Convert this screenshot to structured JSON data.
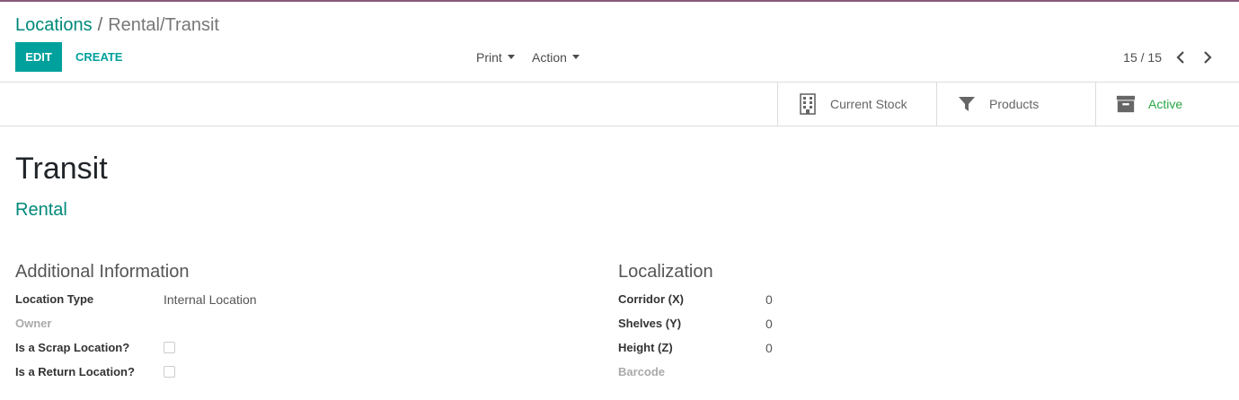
{
  "breadcrumb": {
    "parent": "Locations",
    "separator": "/",
    "current": "Rental/Transit"
  },
  "toolbar": {
    "edit_label": "EDIT",
    "create_label": "CREATE",
    "print_label": "Print",
    "action_label": "Action"
  },
  "pager": {
    "value": "15 / 15"
  },
  "stat_buttons": {
    "current_stock": "Current Stock",
    "products": "Products",
    "active": "Active"
  },
  "record": {
    "title": "Transit",
    "parent_location": "Rental"
  },
  "additional_info": {
    "heading": "Additional Information",
    "location_type_label": "Location Type",
    "location_type_value": "Internal Location",
    "owner_label": "Owner",
    "scrap_label": "Is a Scrap Location?",
    "scrap_checked": false,
    "return_label": "Is a Return Location?",
    "return_checked": false
  },
  "localization": {
    "heading": "Localization",
    "corridor_label": "Corridor (X)",
    "corridor_value": "0",
    "shelves_label": "Shelves (Y)",
    "shelves_value": "0",
    "height_label": "Height (Z)",
    "height_value": "0",
    "barcode_label": "Barcode"
  },
  "colors": {
    "primary": "#00a09d",
    "link": "#00897b",
    "active": "#28a745",
    "top_border": "#875a7b"
  }
}
